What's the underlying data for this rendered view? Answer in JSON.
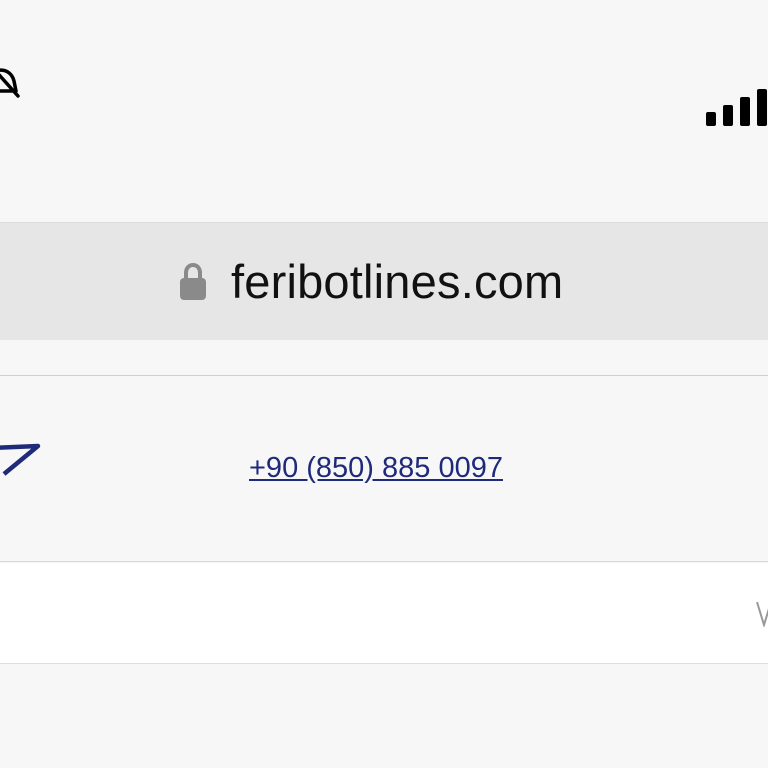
{
  "browser": {
    "url": "feribotlines.com"
  },
  "page": {
    "phone": "+90 (850) 885 0097"
  },
  "icons": {
    "silent": "bell-slash-icon",
    "signal": "cellular-signal-icon",
    "lock": "lock-icon",
    "logo": "logo-mark-icon",
    "chevron": "chevron-down-icon"
  },
  "colors": {
    "link": "#1f2a7a",
    "address_bar": "#e6e6e6",
    "page_background": "#f7f7f7"
  }
}
